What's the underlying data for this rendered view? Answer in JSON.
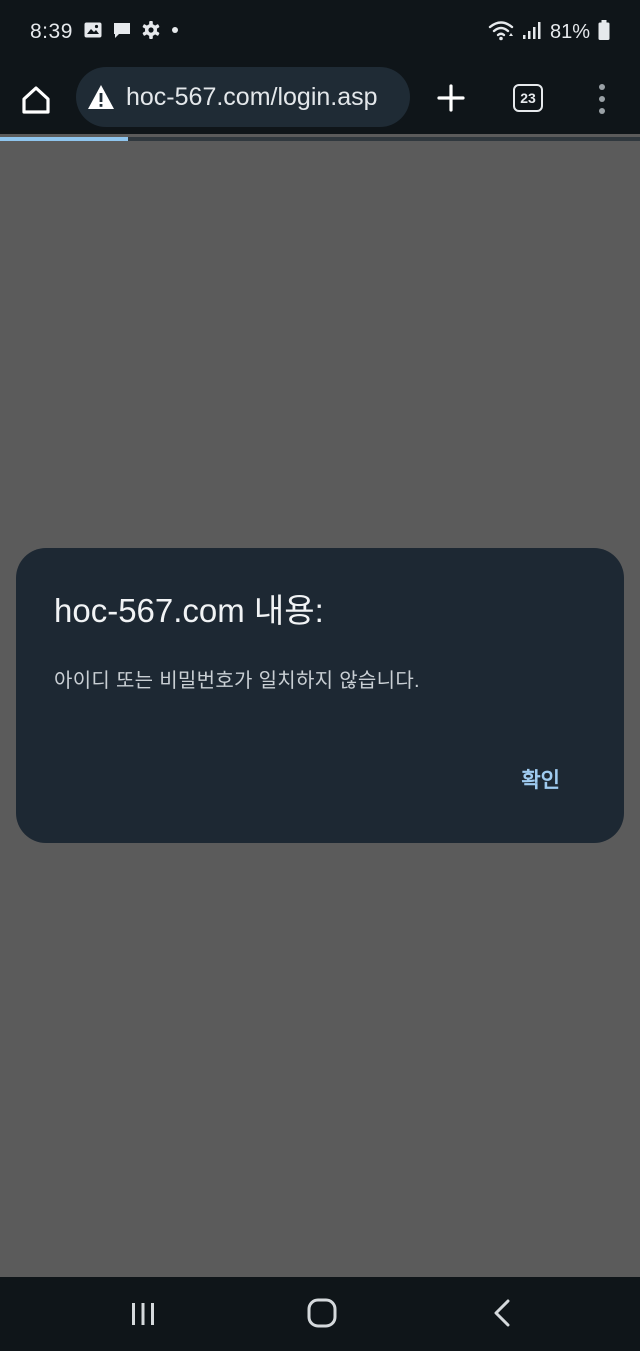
{
  "status_bar": {
    "time": "8:39",
    "left_icons": [
      "gallery-icon",
      "message-icon",
      "settings-icon",
      "dot-icon"
    ],
    "right_icons": [
      "wifi-icon",
      "signal-icon",
      "battery-icon"
    ],
    "battery_percent": "81%"
  },
  "browser": {
    "url": "hoc-567.com/login.asp",
    "tab_count": "23",
    "load_progress": 0.2,
    "icons": {
      "home": "home-icon",
      "warning": "warning-icon",
      "new_tab": "plus-icon",
      "tabs": "tab-switcher-icon",
      "menu": "more-vert-icon"
    }
  },
  "dialog": {
    "title": "hoc-567.com 내용:",
    "message": "아이디 또는 비밀번호가 일치하지 않습니다.",
    "ok_label": "확인"
  },
  "nav_bar": {
    "icons": [
      "recents-icon",
      "home-icon",
      "back-icon"
    ]
  },
  "colors": {
    "bar_background": "#0f1519",
    "page_scrim": "#5b5b5b",
    "dialog_background": "#1d2833",
    "accent": "#9fcbf0"
  }
}
